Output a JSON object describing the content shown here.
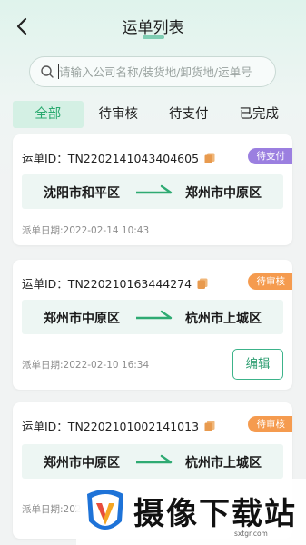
{
  "header": {
    "title": "运单列表"
  },
  "search": {
    "placeholder": "请输入公司名称/装货地/卸货地/运单号"
  },
  "tabs": [
    {
      "label": "全部",
      "active": true
    },
    {
      "label": "待审核",
      "active": false
    },
    {
      "label": "待支付",
      "active": false
    },
    {
      "label": "已完成",
      "active": false
    }
  ],
  "colors": {
    "accent": "#2eaa72",
    "pending_payment": "#9b7fe0",
    "pending_review": "#f59b4f"
  },
  "orders": [
    {
      "waybill": "运单ID：TN2202141043404605",
      "status": "待支付",
      "from": "沈阳市和平区",
      "to": "郑州市中原区",
      "date": "派单日期:2022-02-14 10:43"
    },
    {
      "waybill": "运单ID：TN220210163444274",
      "status": "待审核",
      "from": "郑州市中原区",
      "to": "杭州市上城区",
      "date": "派单日期:2022-02-10 16:34",
      "action": "编辑"
    },
    {
      "waybill": "运单ID：TN2202101002141013",
      "status": "待审核",
      "from": "郑州市中原区",
      "to": "杭州市上城区",
      "date": "派单日期:202"
    }
  ],
  "watermark": {
    "name": "摄像下载站",
    "url": "sxtgr.com"
  }
}
